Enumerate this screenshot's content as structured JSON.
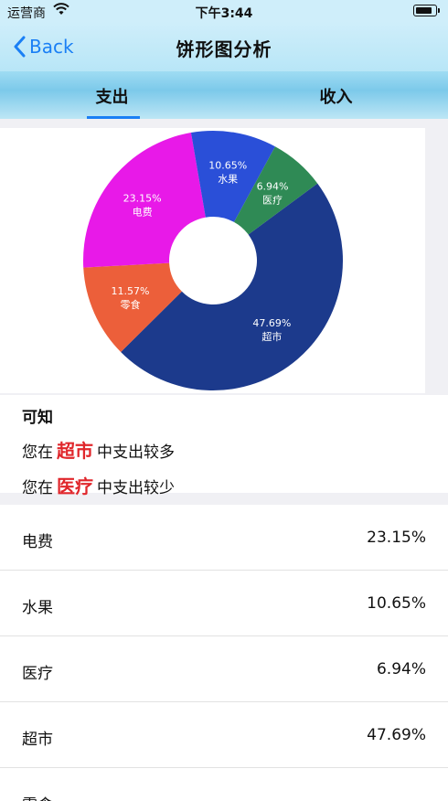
{
  "status": {
    "carrier": "运营商",
    "time": "下午3:44"
  },
  "nav": {
    "back_label": "Back",
    "title": "饼形图分析"
  },
  "tabs": [
    {
      "label": "支出",
      "active": true
    },
    {
      "label": "收入",
      "active": false
    }
  ],
  "chart_data": {
    "type": "pie",
    "donut": true,
    "slices": [
      {
        "label": "超市",
        "percent": "47.69%",
        "value": 47.69,
        "color": "#1c3a8c"
      },
      {
        "label": "零食",
        "percent": "11.57%",
        "value": 11.57,
        "color": "#ec5f3a"
      },
      {
        "label": "电费",
        "percent": "23.15%",
        "value": 23.15,
        "color": "#e819e8"
      },
      {
        "label": "水果",
        "percent": "10.65%",
        "value": 10.65,
        "color": "#2a4fd8"
      },
      {
        "label": "医疗",
        "percent": "6.94%",
        "value": 6.94,
        "color": "#2f8a55"
      }
    ]
  },
  "summary": {
    "heading": "可知",
    "line1_prefix": "您在",
    "line1_highlight": "超市",
    "line1_suffix": "中支出较多",
    "line2_prefix": "您在",
    "line2_highlight": "医疗",
    "line2_suffix": "中支出较少"
  },
  "list": [
    {
      "name": "电费",
      "value": "23.15%"
    },
    {
      "name": "水果",
      "value": "10.65%"
    },
    {
      "name": "医疗",
      "value": "6.94%"
    },
    {
      "name": "超市",
      "value": "47.69%"
    },
    {
      "name": "零食",
      "value": ""
    }
  ]
}
